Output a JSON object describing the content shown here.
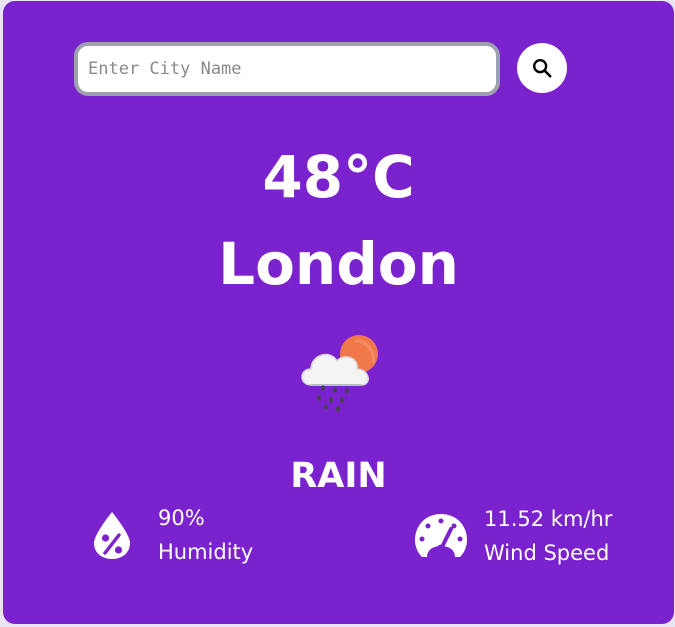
{
  "search": {
    "placeholder": "Enter City Name",
    "button_icon": "search-icon"
  },
  "weather": {
    "temperature": "48°C",
    "city": "London",
    "icon": "cloud-sun-rain-icon",
    "condition": "RAIN"
  },
  "details": {
    "humidity": {
      "value": "90%",
      "label": "Humidity",
      "icon": "humidity-percent-icon"
    },
    "wind": {
      "value": "11.52 km/hr",
      "label": "Wind Speed",
      "icon": "speedometer-icon"
    }
  },
  "colors": {
    "card_background": "#7b22cf",
    "text": "#ffffff",
    "sun": "#f0784a",
    "cloud": "#f4f4f4"
  }
}
